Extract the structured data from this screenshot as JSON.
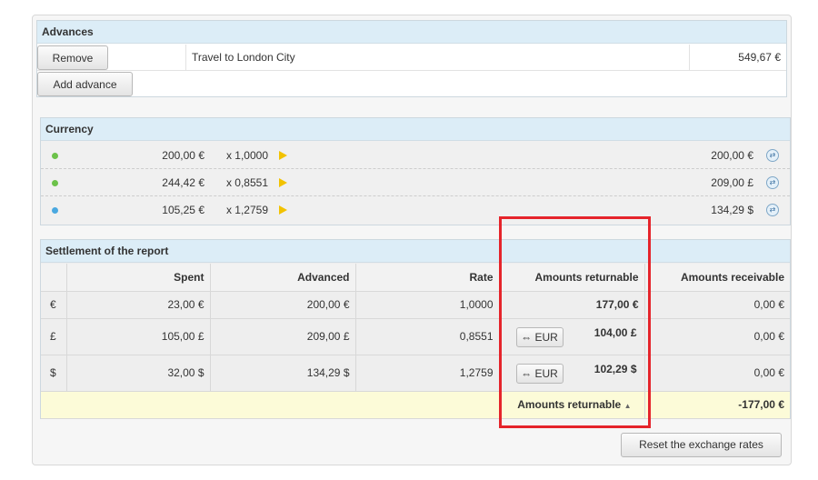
{
  "advances": {
    "title": "Advances",
    "remove_label": "Remove",
    "add_label": "Add advance",
    "item": {
      "description": "Travel to London City",
      "amount": "549,67 €"
    }
  },
  "currency": {
    "title": "Currency",
    "rows": [
      {
        "dot_color": "#6cc24a",
        "amount": "200,00 €",
        "rate": "x 1,0000",
        "result": "200,00 €",
        "icon": "convert-icon"
      },
      {
        "dot_color": "#6cc24a",
        "amount": "244,42 €",
        "rate": "x 0,8551",
        "result": "209,00 £",
        "icon": "convert-icon"
      },
      {
        "dot_color": "#4aa8e0",
        "amount": "105,25 €",
        "rate": "x 1,2759",
        "result": "134,29 $",
        "icon": "convert-icon"
      }
    ]
  },
  "settlement": {
    "title": "Settlement of the report",
    "headers": {
      "spent": "Spent",
      "advanced": "Advanced",
      "rate": "Rate",
      "returnable": "Amounts returnable",
      "receivable": "Amounts receivable"
    },
    "rows": [
      {
        "symbol": "€",
        "spent": "23,00 €",
        "advanced": "200,00 €",
        "rate": "1,0000",
        "returnable": "177,00 €",
        "button": "",
        "receivable": "0,00 €"
      },
      {
        "symbol": "£",
        "spent": "105,00 £",
        "advanced": "209,00 £",
        "rate": "0,8551",
        "returnable": "104,00 £",
        "button": "⇔ EUR",
        "receivable": "0,00 €"
      },
      {
        "symbol": "$",
        "spent": "32,00 $",
        "advanced": "134,29 $",
        "rate": "1,2759",
        "returnable": "102,29 $",
        "button": "⇔ EUR",
        "receivable": "0,00 €"
      }
    ],
    "total": {
      "label": "Amounts returnable",
      "value": "-177,00 €"
    }
  },
  "reset_label": "Reset the exchange rates",
  "colors": {
    "highlight": "#e5242b",
    "header_bg": "#dcedf7",
    "total_bg": "#fcfbd8",
    "arrow": "#f2c200"
  }
}
